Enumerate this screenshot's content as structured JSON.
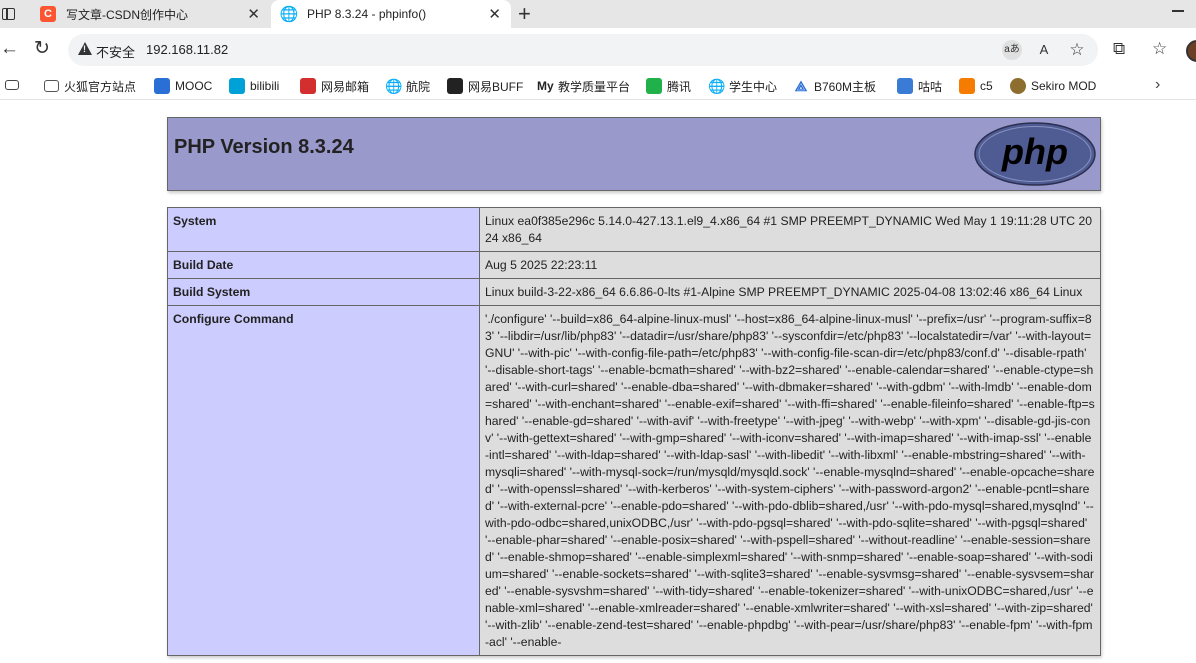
{
  "browser": {
    "tabs": [
      {
        "favicon": "C",
        "title": "写文章-CSDN创作中心",
        "close": "✕"
      },
      {
        "favicon": "🌐",
        "title": "PHP 8.3.24 - phpinfo()",
        "close": "✕"
      }
    ],
    "new_tab": "+",
    "address": {
      "security_label": "不安全",
      "url": "192.168.11.82",
      "read_aloud_label": "aあ",
      "immersive_label": "A"
    }
  },
  "bookmarks": [
    {
      "icon": "folder-icon",
      "label": "火狐官方站点",
      "color": "#666666"
    },
    {
      "icon": "mooc-icon",
      "label": "MOOC",
      "color": "#2a6fd6"
    },
    {
      "icon": "bilibili-icon",
      "label": "bilibili",
      "color": "#00a1d6"
    },
    {
      "icon": "netease-mail-icon",
      "label": "网易邮箱",
      "color": "#d32f2f"
    },
    {
      "icon": "globe-icon",
      "label": "航院",
      "color": "#444444"
    },
    {
      "icon": "buff-icon",
      "label": "网易BUFF",
      "color": "#222222"
    },
    {
      "icon": "my-icon",
      "label": "教学质量平台",
      "color": "#222222"
    },
    {
      "icon": "tencent-video-icon",
      "label": "腾讯",
      "color": "#20b14a"
    },
    {
      "icon": "globe-icon",
      "label": "学生中心",
      "color": "#444444"
    },
    {
      "icon": "aorus-icon",
      "label": "B760M主板",
      "color": "#2a6fd6"
    },
    {
      "icon": "gugu-icon",
      "label": "咕咕",
      "color": "#3a7bd5"
    },
    {
      "icon": "c5-icon",
      "label": "c5",
      "color": "#f57c00"
    },
    {
      "icon": "sekiro-icon",
      "label": "Sekiro MOD",
      "color": "#8d6e2f"
    }
  ],
  "phpinfo": {
    "version_title": "PHP Version 8.3.24",
    "logo_text": "php",
    "rows": [
      {
        "key": "System",
        "value": "Linux ea0f385e296c 5.14.0-427.13.1.el9_4.x86_64 #1 SMP PREEMPT_DYNAMIC Wed May 1 19:11:28 UTC 2024 x86_64"
      },
      {
        "key": "Build Date",
        "value": "Aug 5 2025 22:23:11"
      },
      {
        "key": "Build System",
        "value": "Linux build-3-22-x86_64 6.6.86-0-lts #1-Alpine SMP PREEMPT_DYNAMIC 2025-04-08 13:02:46 x86_64 Linux"
      },
      {
        "key": "Configure Command",
        "value": "'./configure' '--build=x86_64-alpine-linux-musl' '--host=x86_64-alpine-linux-musl' '--prefix=/usr' '--program-suffix=83' '--libdir=/usr/lib/php83' '--datadir=/usr/share/php83' '--sysconfdir=/etc/php83' '--localstatedir=/var' '--with-layout=GNU' '--with-pic' '--with-config-file-path=/etc/php83' '--with-config-file-scan-dir=/etc/php83/conf.d' '--disable-rpath' '--disable-short-tags' '--enable-bcmath=shared' '--with-bz2=shared' '--enable-calendar=shared' '--enable-ctype=shared' '--with-curl=shared' '--enable-dba=shared' '--with-dbmaker=shared' '--with-gdbm' '--with-lmdb' '--enable-dom=shared' '--with-enchant=shared' '--enable-exif=shared' '--with-ffi=shared' '--enable-fileinfo=shared' '--enable-ftp=shared' '--enable-gd=shared' '--with-avif' '--with-freetype' '--with-jpeg' '--with-webp' '--with-xpm' '--disable-gd-jis-conv' '--with-gettext=shared' '--with-gmp=shared' '--with-iconv=shared' '--with-imap=shared' '--with-imap-ssl' '--enable-intl=shared' '--with-ldap=shared' '--with-ldap-sasl' '--with-libedit' '--with-libxml' '--enable-mbstring=shared' '--with-mysqli=shared' '--with-mysql-sock=/run/mysqld/mysqld.sock' '--enable-mysqlnd=shared' '--enable-opcache=shared' '--with-openssl=shared' '--with-kerberos' '--with-system-ciphers' '--with-password-argon2' '--enable-pcntl=shared' '--with-external-pcre' '--enable-pdo=shared' '--with-pdo-dblib=shared,/usr' '--with-pdo-mysql=shared,mysqlnd' '--with-pdo-odbc=shared,unixODBC,/usr' '--with-pdo-pgsql=shared' '--with-pdo-sqlite=shared' '--with-pgsql=shared' '--enable-phar=shared' '--enable-posix=shared' '--with-pspell=shared' '--without-readline' '--enable-session=shared' '--enable-shmop=shared' '--enable-simplexml=shared' '--with-snmp=shared' '--enable-soap=shared' '--with-sodium=shared' '--enable-sockets=shared' '--with-sqlite3=shared' '--enable-sysvmsg=shared' '--enable-sysvsem=shared' '--enable-sysvshm=shared' '--with-tidy=shared' '--enable-tokenizer=shared' '--with-unixODBC=shared,/usr' '--enable-xml=shared' '--enable-xmlreader=shared' '--enable-xmlwriter=shared' '--with-xsl=shared' '--with-zip=shared' '--with-zlib' '--enable-zend-test=shared' '--enable-phpdbg' '--with-pear=/usr/share/php83' '--enable-fpm' '--with-fpm-acl' '--enable-"
      }
    ]
  }
}
